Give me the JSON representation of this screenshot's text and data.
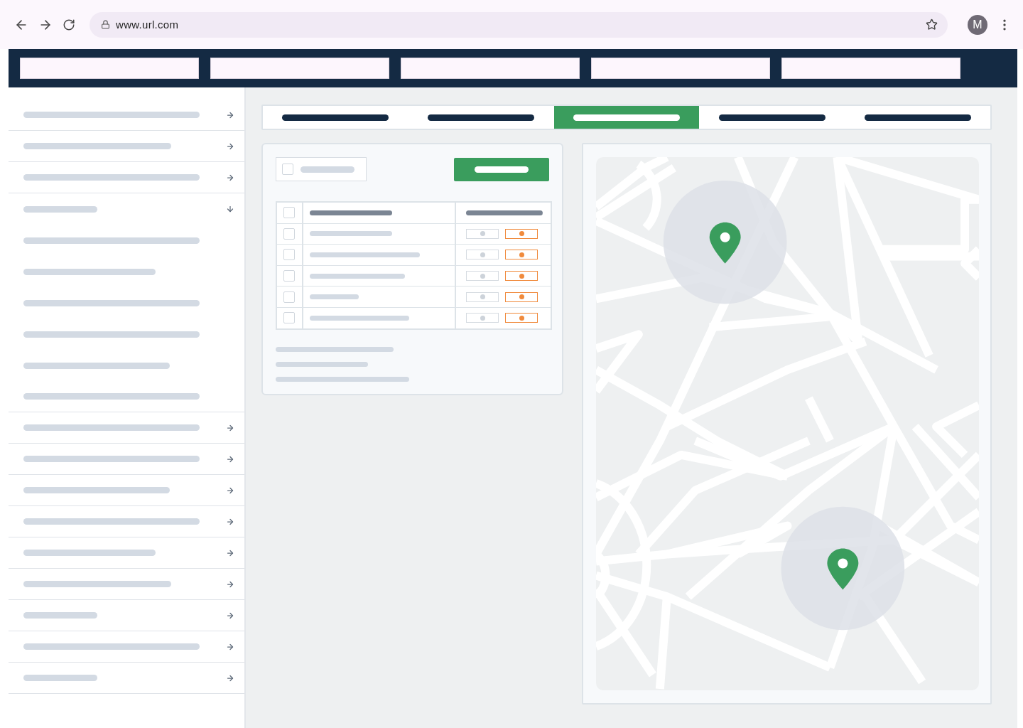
{
  "browser": {
    "url": "www.url.com",
    "avatar": "M"
  },
  "tabs": [
    {
      "selected": false
    },
    {
      "selected": false
    },
    {
      "selected": true
    },
    {
      "selected": false
    },
    {
      "selected": false
    }
  ],
  "sidebar": {
    "items": [
      {
        "kind": "link"
      },
      {
        "kind": "link"
      },
      {
        "kind": "link"
      },
      {
        "kind": "group",
        "expanded": true,
        "children": [
          {
            "kind": "sub"
          },
          {
            "kind": "sub"
          },
          {
            "kind": "sub"
          },
          {
            "kind": "sub"
          },
          {
            "kind": "sub"
          },
          {
            "kind": "sub"
          }
        ]
      },
      {
        "kind": "link"
      },
      {
        "kind": "link"
      },
      {
        "kind": "link"
      },
      {
        "kind": "link"
      },
      {
        "kind": "link"
      },
      {
        "kind": "link"
      },
      {
        "kind": "link"
      },
      {
        "kind": "link"
      },
      {
        "kind": "link"
      }
    ]
  },
  "search": {
    "checked": false
  },
  "table": {
    "header_checked": false,
    "rows": [
      {
        "checked": false
      },
      {
        "checked": false
      },
      {
        "checked": false
      },
      {
        "checked": false
      },
      {
        "checked": false
      }
    ]
  }
}
